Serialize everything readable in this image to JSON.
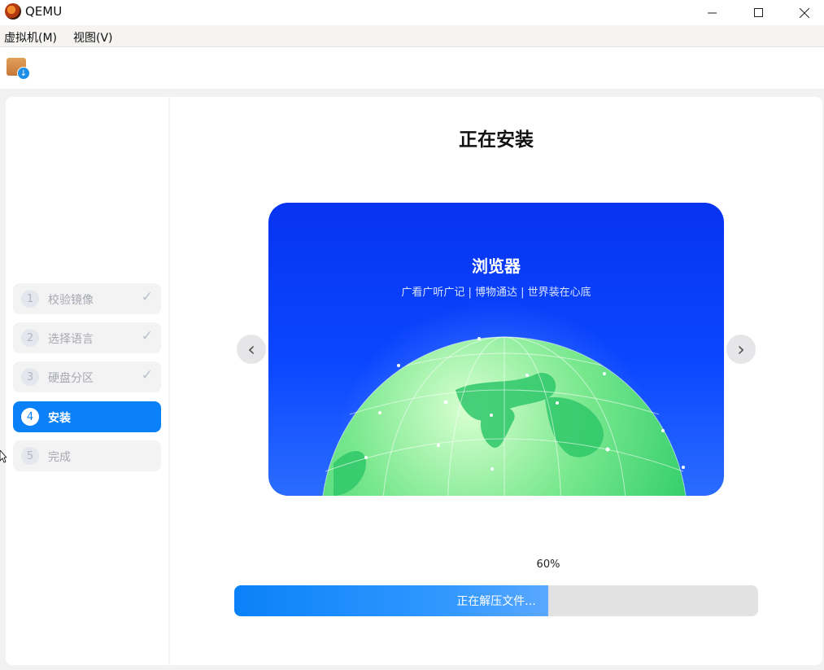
{
  "window": {
    "title": "QEMU",
    "minimize_glyph": "—",
    "maximize_glyph": "☐",
    "close_glyph": "✕"
  },
  "menu": {
    "items": [
      "虚拟机(M)",
      "视图(V)"
    ]
  },
  "toolbar": {
    "icon": "package-download-icon"
  },
  "installer": {
    "title": "正在安装",
    "steps": [
      {
        "num": "1",
        "label": "校验镜像",
        "state": "done"
      },
      {
        "num": "2",
        "label": "选择语言",
        "state": "done"
      },
      {
        "num": "3",
        "label": "硬盘分区",
        "state": "done"
      },
      {
        "num": "4",
        "label": "安装",
        "state": "active"
      },
      {
        "num": "5",
        "label": "完成",
        "state": "pending"
      }
    ],
    "check_glyph": "✓",
    "slide": {
      "title": "浏览器",
      "subtitle": "广看广听广记 | 博物通达 | 世界装在心底"
    },
    "nav": {
      "prev": "‹",
      "next": "›"
    },
    "progress": {
      "percent_text": "60%",
      "value": 0.6,
      "status": "正在解压文件..."
    }
  },
  "colors": {
    "accent": "#0a81f8",
    "slide_bg": "#0b47ff",
    "globe_green": "#2ed66f"
  }
}
